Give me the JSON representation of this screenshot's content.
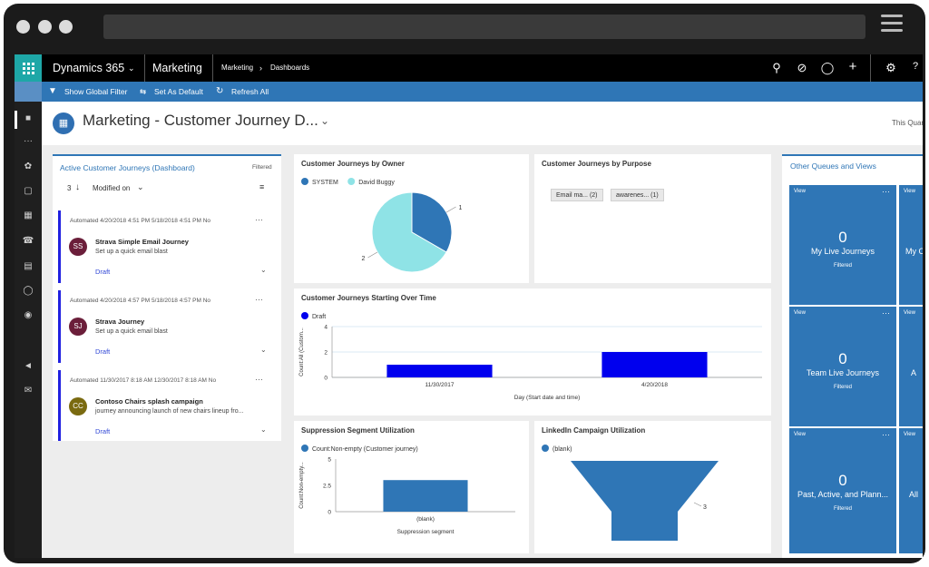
{
  "nav": {
    "app": "Dynamics 365",
    "area": "Marketing",
    "breadcrumb": [
      "Marketing",
      "Dashboards"
    ]
  },
  "command_bar": {
    "show_global_filter": "Show Global Filter",
    "set_as_default": "Set As Default",
    "refresh_all": "Refresh All"
  },
  "header": {
    "title": "Marketing - Customer Journey D...",
    "right_text": "This Quar"
  },
  "journeys_panel": {
    "title": "Active Customer Journeys (Dashboard)",
    "filtered": "Filtered",
    "count": "3",
    "sort": "Modified on",
    "items": [
      {
        "meta": "Automated    4/20/2018 4:51 PM    5/18/2018 4:51 PM    No",
        "initials": "SS",
        "color": "#6b1e3a",
        "name": "Strava Simple Email Journey",
        "desc": "Set up a quick email blast",
        "status": "Draft"
      },
      {
        "meta": "Automated    4/20/2018 4:57 PM    5/18/2018 4:57 PM    No",
        "initials": "SJ",
        "color": "#6b1e3a",
        "name": "Strava Journey",
        "desc": "Set up a quick email blast",
        "status": "Draft"
      },
      {
        "meta": "Automated    11/30/2017 8:18 AM    12/30/2017 8:18 AM    No",
        "initials": "CC",
        "color": "#7a6a10",
        "name": "Contoso Chairs splash campaign",
        "desc": "journey announcing launch of new chairs lineup fro...",
        "status": "Draft"
      }
    ]
  },
  "purpose": {
    "title": "Customer Journeys by Purpose",
    "tags": [
      "Email ma... (2)",
      "awarenes... (1)"
    ]
  },
  "queues": {
    "title": "Other Queues and Views",
    "tiles": [
      {
        "view": "View",
        "count": "0",
        "label": "My Live Journeys",
        "filter": "Filtered"
      },
      {
        "view": "View",
        "count": "0",
        "label": "Team Live Journeys",
        "filter": "Filtered"
      },
      {
        "view": "View",
        "count": "0",
        "label": "Past, Active, and Plann...",
        "filter": "Filtered"
      },
      {
        "view": "View",
        "count": "",
        "label": "My C",
        "filter": ""
      },
      {
        "view": "View",
        "count": "",
        "label": "A",
        "filter": ""
      },
      {
        "view": "View",
        "count": "",
        "label": "All",
        "filter": ""
      }
    ]
  },
  "chart_data": [
    {
      "type": "pie",
      "title": "Customer Journeys by Owner",
      "categories": [
        "SYSTEM",
        "David Buggy"
      ],
      "values": [
        1,
        2
      ],
      "colors": [
        "#2f76b6",
        "#8fe3e6"
      ],
      "legend": "top-left"
    },
    {
      "type": "bar",
      "title": "Customer Journeys Starting Over Time",
      "series": [
        {
          "name": "Draft",
          "values": [
            1,
            2
          ]
        }
      ],
      "categories": [
        "11/30/2017",
        "4/20/2018"
      ],
      "xlabel": "Day (Start date and time)",
      "ylabel": "Count:All (Custom...",
      "ylim": [
        0,
        4
      ],
      "yticks": [
        "0",
        "2",
        "4"
      ],
      "color": "#0000ee",
      "grid": true,
      "legend": "top-left"
    },
    {
      "type": "bar",
      "title": "Suppression Segment Utilization",
      "series": [
        {
          "name": "Count:Non-empty (Customer journey)",
          "values": [
            3
          ]
        }
      ],
      "categories": [
        "(blank)"
      ],
      "xlabel": "Suppression segment",
      "ylabel": "Count:Non-empty...",
      "ylim": [
        0,
        5
      ],
      "yticks": [
        "0",
        "2.5",
        "5"
      ],
      "color": "#2f76b6",
      "legend": "top-left"
    },
    {
      "type": "funnel",
      "title": "LinkedIn Campaign Utilization",
      "categories": [
        "(blank)"
      ],
      "values": [
        3
      ],
      "color": "#2f76b6",
      "legend": "top-left"
    }
  ]
}
